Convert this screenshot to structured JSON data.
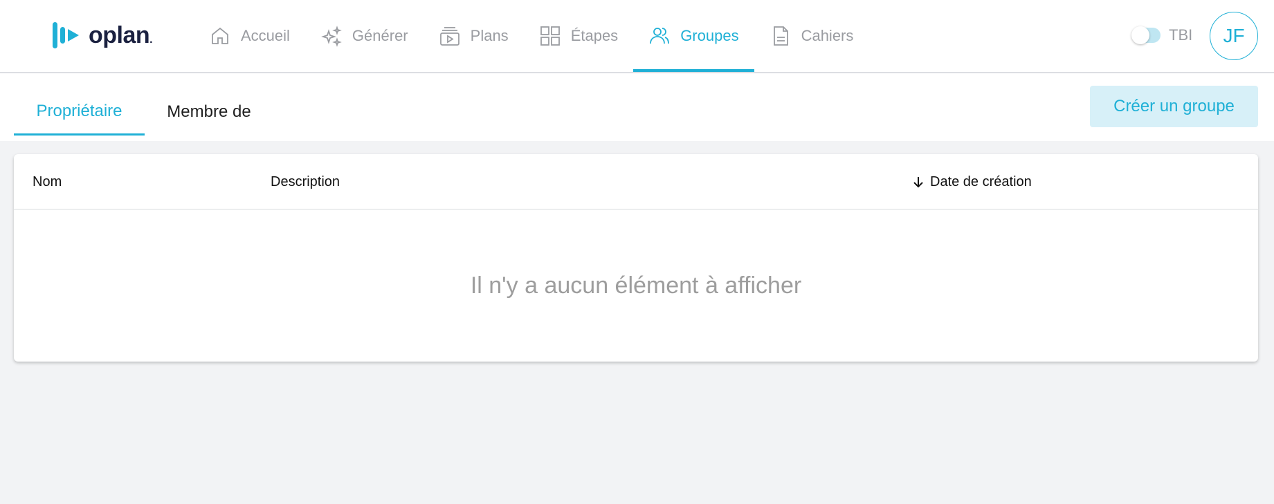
{
  "app": {
    "logo_text": "oplan",
    "logo_dot": ".",
    "brand_color": "#1fb0d6"
  },
  "nav": {
    "items": [
      {
        "label": "Accueil",
        "icon": "home-icon",
        "active": false
      },
      {
        "label": "Générer",
        "icon": "sparkle-icon",
        "active": false
      },
      {
        "label": "Plans",
        "icon": "video-stack-icon",
        "active": false
      },
      {
        "label": "Étapes",
        "icon": "grid-icon",
        "active": false
      },
      {
        "label": "Groupes",
        "icon": "users-icon",
        "active": true
      },
      {
        "label": "Cahiers",
        "icon": "document-icon",
        "active": false
      }
    ]
  },
  "toggle": {
    "label": "TBI",
    "on": false
  },
  "user": {
    "initials": "JF"
  },
  "subtabs": {
    "owner": "Propriétaire",
    "member": "Membre de",
    "active": "owner"
  },
  "actions": {
    "create_group": "Créer un groupe"
  },
  "table": {
    "columns": {
      "name": "Nom",
      "description": "Description",
      "created": "Date de création"
    },
    "sort": {
      "column": "created",
      "direction": "desc",
      "icon": "arrow-down-icon"
    },
    "rows": [],
    "empty_message": "Il n'y a aucun élément à afficher"
  }
}
